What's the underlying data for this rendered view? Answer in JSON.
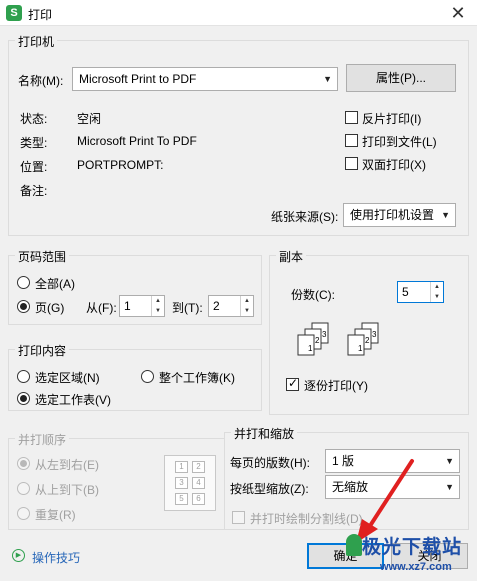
{
  "window": {
    "title": "打印",
    "app_icon_letter": "S"
  },
  "printer": {
    "legend": "打印机",
    "name_label": "名称(M):",
    "name_value": "Microsoft Print to PDF",
    "properties_button": "属性(P)...",
    "status_label": "状态:",
    "status_value": "空闲",
    "type_label": "类型:",
    "type_value": "Microsoft Print To PDF",
    "location_label": "位置:",
    "location_value": "PORTPROMPT:",
    "comment_label": "备注:",
    "reverse_print": {
      "label": "反片打印(I)",
      "checked": false
    },
    "print_to_file": {
      "label": "打印到文件(L)",
      "checked": false
    },
    "duplex": {
      "label": "双面打印(X)",
      "checked": false
    },
    "paper_source_label": "纸张来源(S):",
    "paper_source_value": "使用打印机设置"
  },
  "page_range": {
    "legend": "页码范围",
    "all_label": "全部(A)",
    "pages_label": "页(G)",
    "from_label": "从(F):",
    "from_value": "1",
    "to_label": "到(T):",
    "to_value": "2"
  },
  "copies": {
    "legend": "副本",
    "count_label": "份数(C):",
    "count_value": "5",
    "collate_label": "逐份打印(Y)",
    "collate_checked": true,
    "stack_pages": [
      "1",
      "2",
      "3"
    ]
  },
  "print_content": {
    "legend": "打印内容",
    "selection_label": "选定区域(N)",
    "whole_workbook_label": "整个工作簿(K)",
    "active_sheet_label": "选定工作表(V)"
  },
  "order": {
    "legend": "并打顺序",
    "left_to_right": "从左到右(E)",
    "top_to_bottom": "从上到下(B)",
    "repeat": "重复(R)",
    "preview_cells": [
      "1",
      "2",
      "3",
      "4",
      "5",
      "6"
    ]
  },
  "scaling": {
    "legend": "并打和缩放",
    "pages_per_sheet_label": "每页的版数(H):",
    "pages_per_sheet_value": "1 版",
    "scale_to_paper_label": "按纸型缩放(Z):",
    "scale_to_paper_value": "无缩放",
    "draw_dividers_label": "并打时绘制分割线(D)"
  },
  "footer": {
    "tips_link": "操作技巧",
    "ok_button": "确定",
    "close_button": "关闭"
  },
  "watermark": {
    "site_name": "极光下载站",
    "url": "www.xz7.com"
  },
  "colors": {
    "accent": "#0078d7",
    "brand_green": "#2fa04e",
    "link": "#2666b8",
    "annotation_red": "#e02020"
  }
}
